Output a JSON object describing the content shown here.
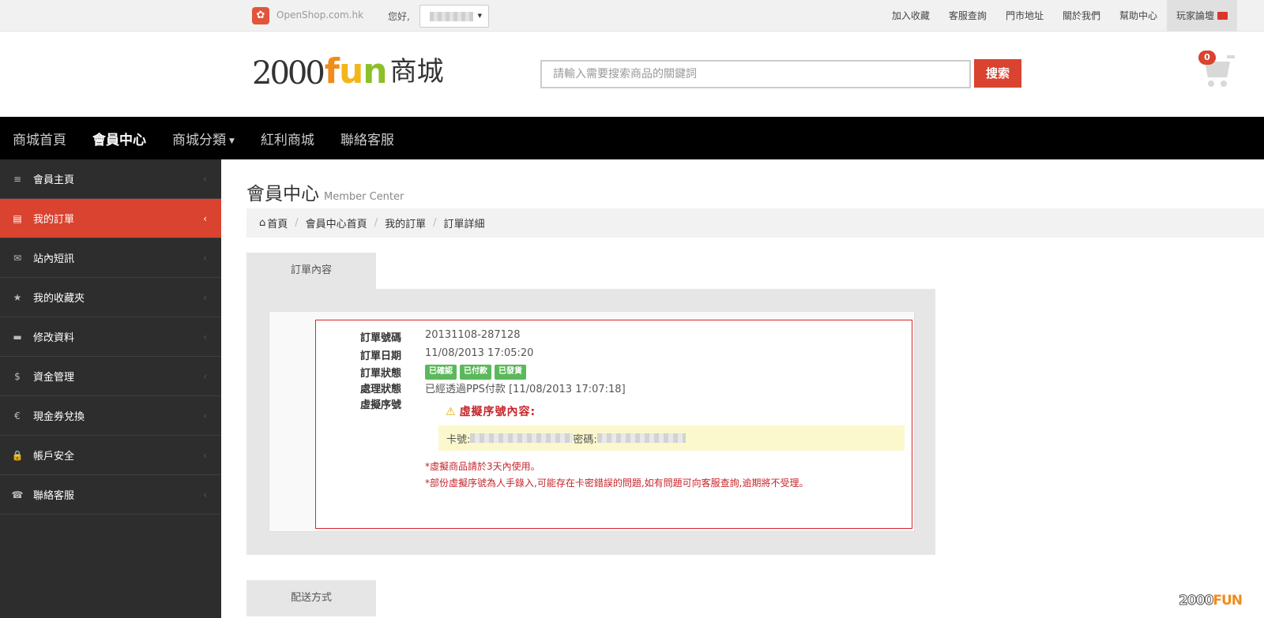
{
  "topbar": {
    "site": "OpenShop.com.hk",
    "greeting": "您好,",
    "links": [
      "加入收藏",
      "客服查詢",
      "門市地址",
      "關於我們",
      "幫助中心"
    ],
    "forum": "玩家論壇"
  },
  "header": {
    "brand_num": "2000",
    "brand_f": "f",
    "brand_u": "u",
    "brand_n": "n",
    "brand_mall": "商城",
    "search_placeholder": "請輸入需要搜索商品的關鍵詞",
    "search_button": "搜索",
    "cart_count": "0"
  },
  "nav": [
    "商城首頁",
    "會員中心",
    "商城分類",
    "紅利商城",
    "聯絡客服"
  ],
  "sidebar": [
    {
      "icon": "menu-icon",
      "glyph": "≡",
      "label": "會員主頁"
    },
    {
      "icon": "order-icon",
      "glyph": "▤",
      "label": "我的訂單",
      "active": true
    },
    {
      "icon": "mail-icon",
      "glyph": "✉",
      "label": "站內短訊"
    },
    {
      "icon": "star-icon",
      "glyph": "★",
      "label": "我的收藏夾"
    },
    {
      "icon": "folder-icon",
      "glyph": "▬",
      "label": "修改資料"
    },
    {
      "icon": "dollar-icon",
      "glyph": "$",
      "label": "資金管理"
    },
    {
      "icon": "euro-icon",
      "glyph": "€",
      "label": "現金券兌換"
    },
    {
      "icon": "lock-icon",
      "glyph": "🔒",
      "label": "帳戶安全"
    },
    {
      "icon": "phone-icon",
      "glyph": "☎",
      "label": "聯絡客服"
    }
  ],
  "page": {
    "title": "會員中心",
    "subtitle": "Member Center",
    "breadcrumb": [
      "首頁",
      "會員中心首頁",
      "我的訂單",
      "訂單詳細"
    ]
  },
  "order": {
    "tab": "訂單內容",
    "fields": {
      "no_label": "訂單號碼",
      "no_value": "20131108-287128",
      "date_label": "訂單日期",
      "date_value": "11/08/2013 17:05:20",
      "status_label": "訂單狀態",
      "process_label": "處理狀態",
      "process_value": "已經透過PPS付款 [11/08/2013 17:07:18]",
      "serial_label": "虛擬序號"
    },
    "badges": [
      "已確認",
      "已付款",
      "已發貨"
    ],
    "serial_title": "虛擬序號內容:",
    "card_label": "卡號:",
    "password_label": "密碼:",
    "note1": "*虛擬商品請於3天內使用。",
    "note2": "*部份虛擬序號為人手錄入,可能存在卡密錯誤的問題,如有問題可向客服查詢,逾期將不受理。"
  },
  "shipping": {
    "tab": "配送方式"
  },
  "corner": {
    "num": "2000",
    "word": "FUN"
  },
  "colors": {
    "accent": "#d9432f",
    "badge": "#5cb85c",
    "nav_bg": "#000000",
    "sidebar_bg": "#2d2d2d"
  }
}
